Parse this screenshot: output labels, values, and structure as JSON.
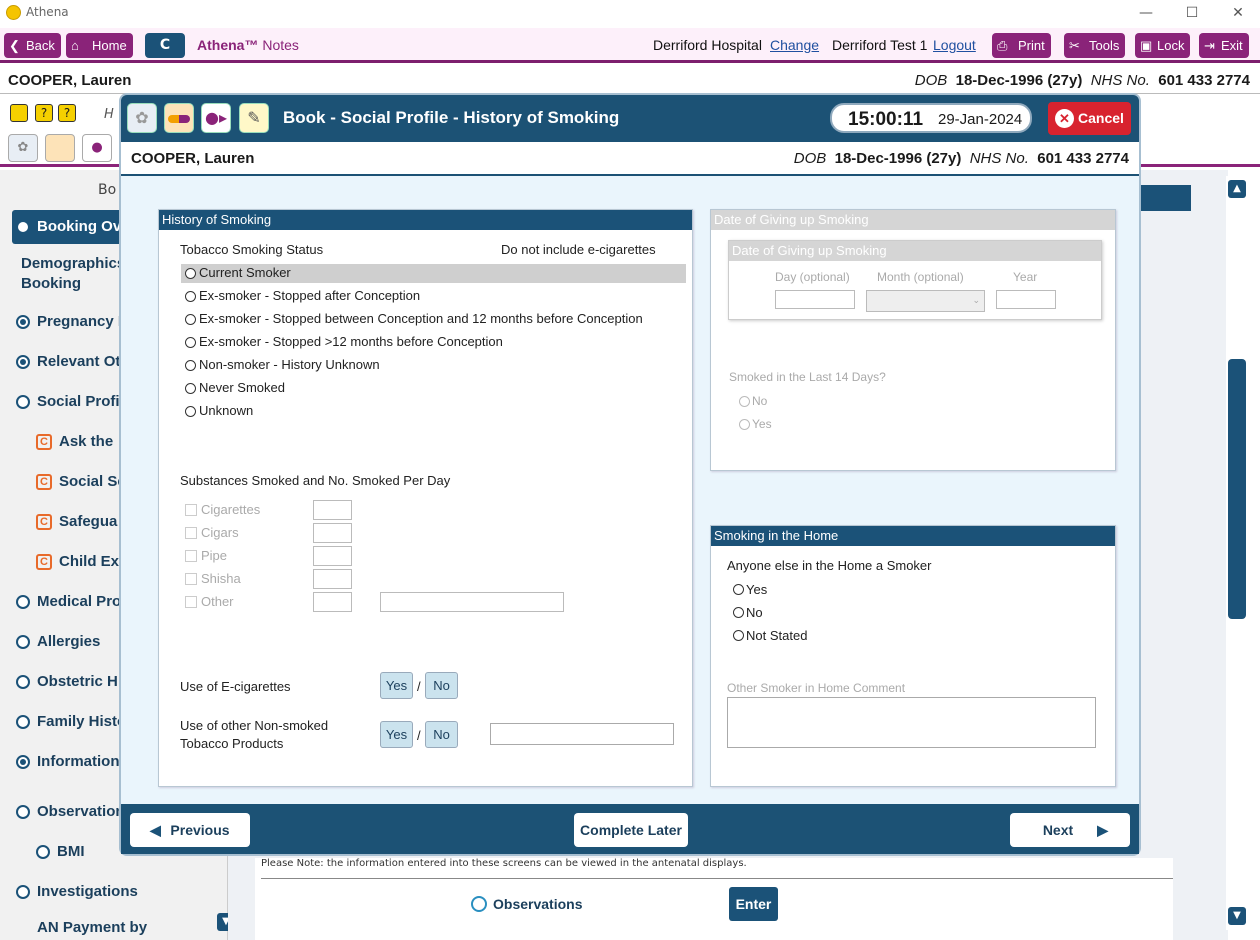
{
  "window": {
    "title": "Athena"
  },
  "topnav": {
    "back": "Back",
    "home": "Home",
    "c": "C",
    "app_name": "Athena™",
    "app_section": "Notes",
    "hospital": "Derriford Hospital",
    "change": "Change",
    "user": "Derriford Test 1",
    "logout": "Logout",
    "print": "Print",
    "tools": "Tools",
    "lock": "Lock",
    "exit": "Exit"
  },
  "patient": {
    "name": "COOPER, Lauren",
    "dob_label": "DOB",
    "dob": "18-Dec-1996 (27y)",
    "nhs_label": "NHS No.",
    "nhs": "601 433 2774"
  },
  "sidebar": {
    "header": "Bo",
    "items": [
      {
        "label": "Booking Ov"
      },
      {
        "label": "Demographics"
      },
      {
        "label": "Booking"
      },
      {
        "label": "Pregnancy I"
      },
      {
        "label": "Relevant Ot"
      },
      {
        "label": "Social Profil"
      },
      {
        "label": "Ask the"
      },
      {
        "label": "Social Se"
      },
      {
        "label": "Safegua"
      },
      {
        "label": "Child Exp"
      },
      {
        "label": "Medical Pro"
      },
      {
        "label": "Allergies"
      },
      {
        "label": "Obstetric H"
      },
      {
        "label": "Family Histo"
      },
      {
        "label": "Information"
      },
      {
        "label": "Observation"
      },
      {
        "label": "BMI"
      },
      {
        "label": "Investigations"
      },
      {
        "label": "AN Payment by"
      }
    ]
  },
  "modal": {
    "title": "Book - Social Profile - History of Smoking",
    "time": "15:00:11",
    "date": "29-Jan-2024",
    "cancel": "Cancel",
    "history": {
      "header": "History of Smoking",
      "status_label": "Tobacco Smoking Status",
      "note": "Do not include e-cigarettes",
      "options": [
        "Current Smoker",
        "Ex-smoker - Stopped after Conception",
        "Ex-smoker - Stopped between Conception and 12 months before Conception",
        "Ex-smoker - Stopped >12 months before Conception",
        "Non-smoker - History Unknown",
        "Never Smoked",
        "Unknown"
      ],
      "selected_row": "Current Smoker",
      "substances_label": "Substances Smoked and No. Smoked Per Day",
      "substances": [
        "Cigarettes",
        "Cigars",
        "Pipe",
        "Shisha",
        "Other"
      ],
      "ecig_label": "Use of E-cigarettes",
      "other_label_1": "Use of other Non-smoked",
      "other_label_2": "Tobacco Products",
      "yes": "Yes",
      "no": "No",
      "slash": "/"
    },
    "giving_up": {
      "header": "Date of Giving up Smoking",
      "sub_header": "Date of Giving up Smoking",
      "day": "Day (optional)",
      "month": "Month (optional)",
      "year": "Year",
      "last14": "Smoked in the Last 14 Days?",
      "no": "No",
      "yes": "Yes"
    },
    "home": {
      "header": "Smoking in the Home",
      "question": "Anyone else in the Home a Smoker",
      "options": [
        "Yes",
        "No",
        "Not Stated"
      ],
      "comment_label": "Other Smoker in Home Comment"
    },
    "footer": {
      "previous": "Previous",
      "complete_later": "Complete Later",
      "next": "Next"
    }
  },
  "background": {
    "note": "Please Note: the information entered into these screens can be viewed in the antenatal displays.",
    "observations": "Observations",
    "enter": "Enter",
    "tool_h": "H"
  }
}
